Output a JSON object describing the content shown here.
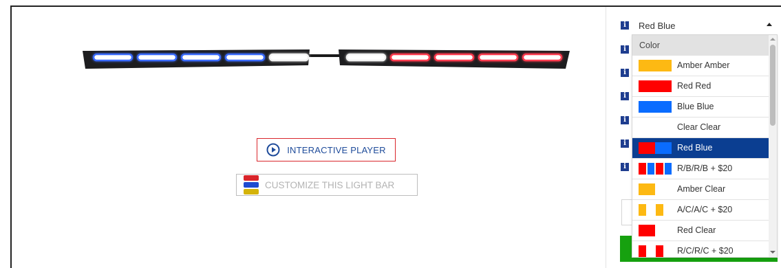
{
  "media": {
    "interactive_player_label": "INTERACTIVE PLAYER",
    "customize_label": "CUSTOMIZE THIS LIGHT BAR",
    "light_bar_colors": {
      "left_segments": [
        "blue",
        "blue",
        "blue",
        "blue",
        "clear"
      ],
      "right_segments": [
        "clear",
        "red",
        "red",
        "red",
        "red"
      ],
      "blue": "#3a6bff",
      "red": "#ff3b4e",
      "clear": "#f2f2f2"
    }
  },
  "color_select": {
    "selected_value": "Red Blue",
    "header": "Color",
    "options": [
      {
        "label": "Amber Amber",
        "swatch": [
          "#fdb913",
          "#fdb913"
        ],
        "selected": false
      },
      {
        "label": "Red Red",
        "swatch": [
          "#ff0000",
          "#ff0000"
        ],
        "selected": false
      },
      {
        "label": "Blue Blue",
        "swatch": [
          "#0a6cff",
          "#0a6cff"
        ],
        "selected": false
      },
      {
        "label": "Clear Clear",
        "swatch": [
          "#ffffff",
          "#ffffff"
        ],
        "selected": false
      },
      {
        "label": "Red Blue",
        "swatch": [
          "#ff0000",
          "#0a6cff"
        ],
        "selected": true
      },
      {
        "label": "R/B/R/B + $20",
        "swatch": [
          "#ff0000",
          "#0a6cff",
          "#ff0000",
          "#0a6cff"
        ],
        "selected": false
      },
      {
        "label": "Amber Clear",
        "swatch": [
          "#fdb913",
          "#ffffff"
        ],
        "selected": false
      },
      {
        "label": "A/C/A/C + $20",
        "swatch": [
          "#fdb913",
          "#ffffff",
          "#fdb913",
          "#ffffff"
        ],
        "selected": false
      },
      {
        "label": "Red Clear",
        "swatch": [
          "#ff0000",
          "#ffffff"
        ],
        "selected": false
      },
      {
        "label": "R/C/R/C + $20",
        "swatch": [
          "#ff0000",
          "#ffffff",
          "#ff0000",
          "#ffffff"
        ],
        "selected": false
      }
    ]
  },
  "colors": {
    "selected_bg": "#0b3e91",
    "info_icon": "#1e3d8f",
    "add_button": "#16a10f",
    "player_border": "#d9252b"
  }
}
